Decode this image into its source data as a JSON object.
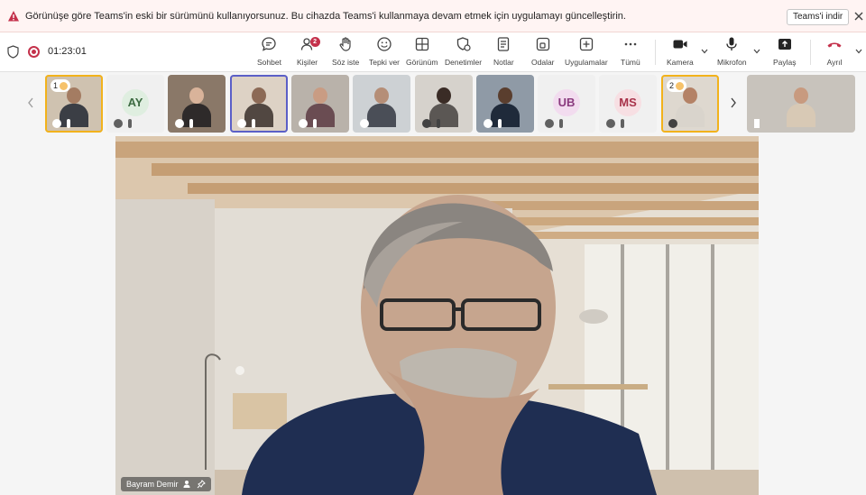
{
  "banner": {
    "message": "Görünüşe göre Teams'in eski bir sürümünü kullanıyorsunuz. Bu cihazda Teams'i kullanmaya devam etmek için uygulamayı güncelleştirin.",
    "download_label": "Teams'i indir"
  },
  "toolbar": {
    "timer": "01:23:01",
    "items": [
      {
        "label": "Sohbet",
        "icon": "chat-icon"
      },
      {
        "label": "Kişiler",
        "icon": "people-icon",
        "badge": "2"
      },
      {
        "label": "Söz iste",
        "icon": "raise-hand-icon"
      },
      {
        "label": "Tepki ver",
        "icon": "emoji-icon"
      },
      {
        "label": "Görünüm",
        "icon": "view-grid-icon"
      },
      {
        "label": "Denetimler",
        "icon": "shield-gear-icon"
      },
      {
        "label": "Notlar",
        "icon": "notes-icon"
      },
      {
        "label": "Odalar",
        "icon": "rooms-icon"
      },
      {
        "label": "Uygulamalar",
        "icon": "apps-icon"
      },
      {
        "label": "Tümü",
        "icon": "more-icon"
      },
      {
        "label": "Kamera",
        "icon": "camera-icon"
      },
      {
        "label": "Mikrofon",
        "icon": "microphone-icon"
      },
      {
        "label": "Paylaş",
        "icon": "share-icon"
      },
      {
        "label": "Ayrıl",
        "icon": "hangup-icon"
      }
    ]
  },
  "gallery": {
    "tiles": [
      {
        "kind": "video",
        "order": "1",
        "highlight": "yellow"
      },
      {
        "kind": "avatar",
        "initials": "AY"
      },
      {
        "kind": "video"
      },
      {
        "kind": "video",
        "highlight": "blue"
      },
      {
        "kind": "video"
      },
      {
        "kind": "video"
      },
      {
        "kind": "video"
      },
      {
        "kind": "video"
      },
      {
        "kind": "avatar",
        "initials": "UB"
      },
      {
        "kind": "avatar",
        "initials": "MS"
      },
      {
        "kind": "video",
        "order": "2",
        "highlight": "yellow"
      },
      {
        "kind": "video"
      }
    ]
  },
  "stage": {
    "speaker_name": "Bayram Demir"
  },
  "colors": {
    "warning": "#c4314b",
    "highlight_yellow": "#f2b21b",
    "highlight_blue": "#5b5fc7"
  }
}
